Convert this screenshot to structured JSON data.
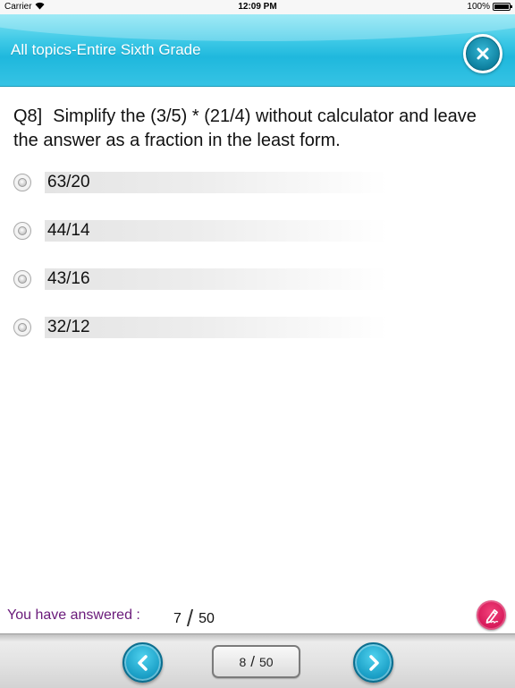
{
  "status_bar": {
    "carrier": "Carrier",
    "time": "12:09 PM",
    "battery": "100%",
    "battery_level": 1
  },
  "header": {
    "title": "All topics-Entire Sixth Grade",
    "close_icon": "close-icon"
  },
  "question": {
    "number": "Q8]",
    "text": "Simplify the (3/5) * (21/4) without calculator and leave the answer as a fraction in the least form."
  },
  "options": [
    {
      "label": "63/20"
    },
    {
      "label": "44/14"
    },
    {
      "label": "43/16"
    },
    {
      "label": "32/12"
    }
  ],
  "progress": {
    "label": "You have answered :",
    "answered": "7",
    "total": "50",
    "separator": "/"
  },
  "pagination": {
    "current": "8",
    "total": "50",
    "separator": "/"
  },
  "colors": {
    "header": "#2cc0e2",
    "accent_purple": "#6a1a7a",
    "pen_button": "#d21354",
    "nav_button": "#1a9fc6"
  },
  "icons": {
    "prev": "chevron-left-icon",
    "next": "chevron-right-icon",
    "pen": "pen-icon",
    "wifi": "wifi-icon",
    "battery": "battery-icon"
  }
}
